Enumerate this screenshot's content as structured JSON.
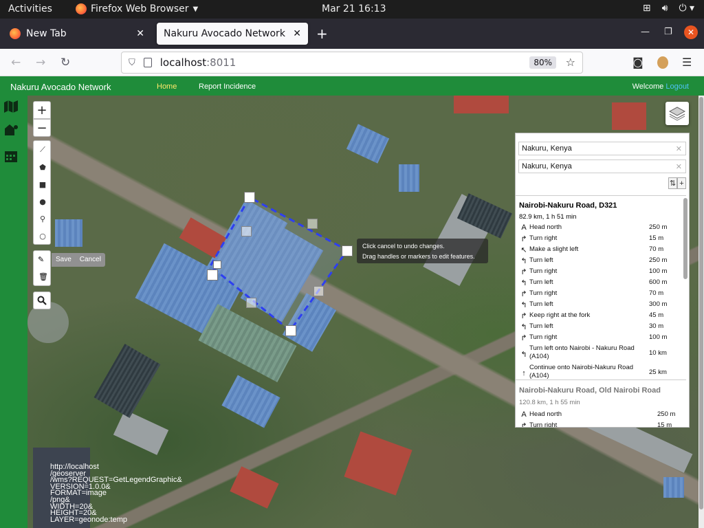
{
  "system_bar": {
    "activities": "Activities",
    "app_name": "Firefox Web Browser",
    "clock": "Mar 21  16:13"
  },
  "browser": {
    "tabs": [
      {
        "label": "New Tab",
        "active": false
      },
      {
        "label": "Nakuru Avocado Network",
        "active": true
      }
    ],
    "url_host": "localhost",
    "url_port": ":8011",
    "zoom": "80%"
  },
  "app": {
    "brand": "Nakuru Avocado Network",
    "nav": {
      "home": "Home",
      "report": "Report Incidence"
    },
    "welcome": "Welcome",
    "logout": "Logout"
  },
  "map": {
    "zoom_in": "+",
    "zoom_out": "−",
    "edit_actions": {
      "save": "Save",
      "cancel": "Cancel"
    },
    "tooltip_line1": "Click cancel to undo changes.",
    "tooltip_line2": "Drag handles or markers to edit features.",
    "legend_text": "http://localhost\n/geoserver\n/wms?REQUEST=GetLegendGraphic&\nVERSION=1.0.0&\nFORMAT=image\n/png&\nWIDTH=20&\nHEIGHT=20&\nLAYER=geonode:temp"
  },
  "routing": {
    "from": "Nakuru, Kenya",
    "to": "Nakuru, Kenya",
    "routes": [
      {
        "name": "Nairobi-Nakuru Road, D321",
        "summary": "82.9 km, 1 h 51 min",
        "steps": [
          {
            "icon": "A",
            "text": "Head north",
            "dist": "250 m"
          },
          {
            "icon": "↱",
            "text": "Turn right",
            "dist": "15 m"
          },
          {
            "icon": "↖",
            "text": "Make a slight left",
            "dist": "70 m"
          },
          {
            "icon": "↰",
            "text": "Turn left",
            "dist": "250 m"
          },
          {
            "icon": "↱",
            "text": "Turn right",
            "dist": "100 m"
          },
          {
            "icon": "↰",
            "text": "Turn left",
            "dist": "600 m"
          },
          {
            "icon": "↱",
            "text": "Turn right",
            "dist": "70 m"
          },
          {
            "icon": "↰",
            "text": "Turn left",
            "dist": "300 m"
          },
          {
            "icon": "↱",
            "text": "Keep right at the fork",
            "dist": "45 m"
          },
          {
            "icon": "↰",
            "text": "Turn left",
            "dist": "30 m"
          },
          {
            "icon": "↱",
            "text": "Turn right",
            "dist": "100 m"
          },
          {
            "icon": "↰",
            "text": "Turn left onto Nairobi - Nakuru Road (A104)",
            "dist": "10 km"
          },
          {
            "icon": "↑",
            "text": "Continue onto Nairobi-Nakuru Road (A104)",
            "dist": "25 km"
          }
        ]
      },
      {
        "name": "Nairobi-Nakuru Road, Old Nairobi Road",
        "summary": "120.8 km, 1 h 55 min",
        "steps": [
          {
            "icon": "A",
            "text": "Head north",
            "dist": "250 m"
          },
          {
            "icon": "↱",
            "text": "Turn right",
            "dist": "15 m"
          }
        ]
      }
    ]
  }
}
